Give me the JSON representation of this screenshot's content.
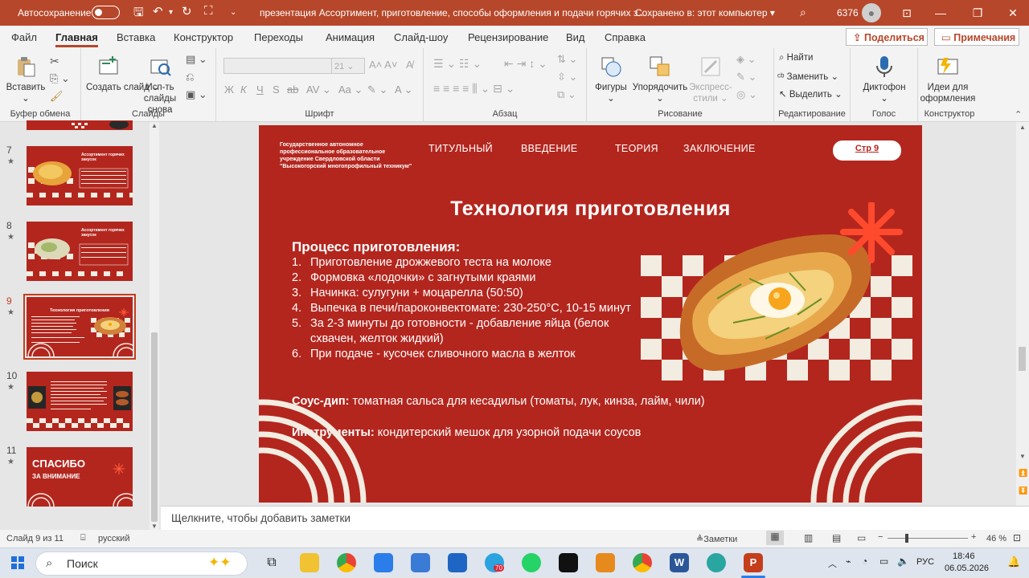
{
  "titlebar": {
    "autosave_label": "Автосохранение",
    "document_title": "презентация Ассортимент, приготовление, способы оформления и подачи горячих з...",
    "saved_status": "Сохранено в: этот компьютер",
    "account_count": "6376"
  },
  "menu": {
    "tabs": [
      "Файл",
      "Главная",
      "Вставка",
      "Конструктор",
      "Переходы",
      "Анимация",
      "Слайд-шоу",
      "Рецензирование",
      "Вид",
      "Справка"
    ],
    "active_tab": "Главная",
    "share_label": "Поделиться",
    "comments_label": "Примечания"
  },
  "ribbon": {
    "clipboard": {
      "paste": "Вставить",
      "group": "Буфер обмена"
    },
    "slides": {
      "new_slide": "Создать слайд",
      "reuse": "Исп-ть слайды снова",
      "group": "Слайды"
    },
    "font": {
      "size": "21",
      "group": "Шрифт"
    },
    "paragraph": {
      "group": "Абзац"
    },
    "drawing": {
      "shapes": "Фигуры",
      "arrange": "Упорядочить",
      "quick_styles": "Экспресс-стили",
      "group": "Рисование"
    },
    "editing": {
      "find": "Найти",
      "replace": "Заменить",
      "select": "Выделить",
      "group": "Редактирование"
    },
    "voice": {
      "dictate": "Диктофон",
      "group": "Голос"
    },
    "designer": {
      "ideas": "Идеи для оформления",
      "group": "Конструктор"
    }
  },
  "thumbnails": [
    {
      "num": "7",
      "title": "Ассортимент горячих закусок"
    },
    {
      "num": "8",
      "title": "Ассортимент горячих закусок"
    },
    {
      "num": "9",
      "title": "Технология приготовления",
      "selected": true
    },
    {
      "num": "10",
      "title": ""
    },
    {
      "num": "11",
      "title": "СПАСИБО",
      "subtitle": "ЗА ВНИМАНИЕ"
    }
  ],
  "slide": {
    "org": "Государственное автономное профессиональное образовательное учреждение Свердловской области \"Высокогорский многопрофильный техникум\"",
    "nav": [
      "ТИТУЛЬНЫЙ",
      "ВВЕДЕНИЕ",
      "ТЕОРИЯ",
      "ЗАКЛЮЧЕНИЕ"
    ],
    "page": "Стр 9",
    "title": "Технология приготовления",
    "process_heading": "Процесс приготовления:",
    "steps": [
      "Приготовление дрожжевого теста на молоке",
      "Формовка «лодочки» с загнутыми краями",
      "Начинка: сулугуни + моцарелла (50:50)",
      "Выпечка в печи/пароконвектомате: 230-250°C, 10-15 минут",
      "За 2-3 минуты до готовности - добавление яйца (белок схвачен, желток жидкий)",
      "При подаче - кусочек сливочного масла в желток"
    ],
    "sauce_label": "Соус-дип:",
    "sauce_text": " томатная сальса для кесадильи (томаты, лук, кинза, лайм, чили)",
    "tools_label": "Инструменты:",
    "tools_text": " кондитерский мешок для узорной подачи соусов"
  },
  "notes_placeholder": "Щелкните, чтобы добавить заметки",
  "status": {
    "slide_info": "Слайд 9 из 11",
    "language": "русский",
    "notes_button": "Заметки",
    "zoom": "46 %"
  },
  "taskbar": {
    "search_label": "Поиск",
    "telegram_badge": "70",
    "lang": "РУС",
    "time": "18:46",
    "date": "06.05.2026"
  },
  "colors": {
    "accent": "#b7472a",
    "slide_bg": "#b3261e",
    "checker": "#f2ece1"
  }
}
